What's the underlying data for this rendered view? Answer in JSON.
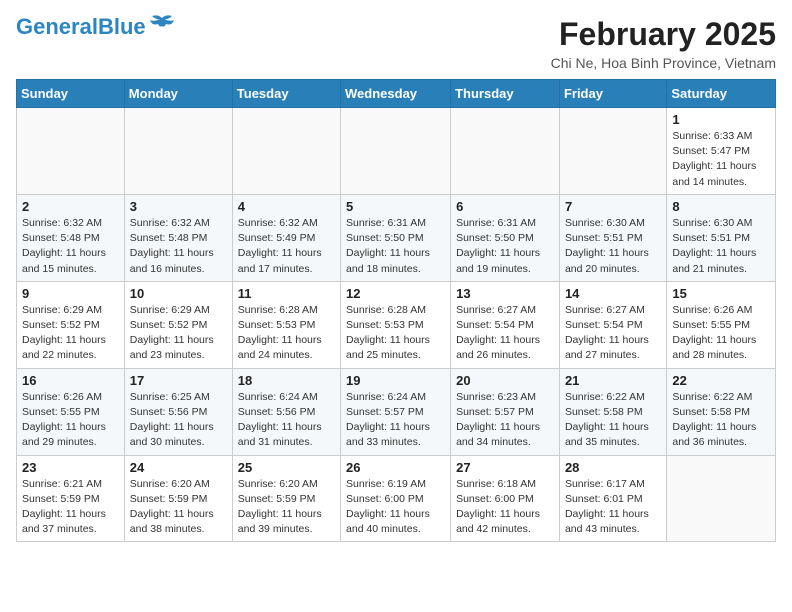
{
  "header": {
    "logo_line1": "General",
    "logo_line2": "Blue",
    "month_year": "February 2025",
    "location": "Chi Ne, Hoa Binh Province, Vietnam"
  },
  "weekdays": [
    "Sunday",
    "Monday",
    "Tuesday",
    "Wednesday",
    "Thursday",
    "Friday",
    "Saturday"
  ],
  "weeks": [
    [
      {
        "day": "",
        "info": ""
      },
      {
        "day": "",
        "info": ""
      },
      {
        "day": "",
        "info": ""
      },
      {
        "day": "",
        "info": ""
      },
      {
        "day": "",
        "info": ""
      },
      {
        "day": "",
        "info": ""
      },
      {
        "day": "1",
        "info": "Sunrise: 6:33 AM\nSunset: 5:47 PM\nDaylight: 11 hours\nand 14 minutes."
      }
    ],
    [
      {
        "day": "2",
        "info": "Sunrise: 6:32 AM\nSunset: 5:48 PM\nDaylight: 11 hours\nand 15 minutes."
      },
      {
        "day": "3",
        "info": "Sunrise: 6:32 AM\nSunset: 5:48 PM\nDaylight: 11 hours\nand 16 minutes."
      },
      {
        "day": "4",
        "info": "Sunrise: 6:32 AM\nSunset: 5:49 PM\nDaylight: 11 hours\nand 17 minutes."
      },
      {
        "day": "5",
        "info": "Sunrise: 6:31 AM\nSunset: 5:50 PM\nDaylight: 11 hours\nand 18 minutes."
      },
      {
        "day": "6",
        "info": "Sunrise: 6:31 AM\nSunset: 5:50 PM\nDaylight: 11 hours\nand 19 minutes."
      },
      {
        "day": "7",
        "info": "Sunrise: 6:30 AM\nSunset: 5:51 PM\nDaylight: 11 hours\nand 20 minutes."
      },
      {
        "day": "8",
        "info": "Sunrise: 6:30 AM\nSunset: 5:51 PM\nDaylight: 11 hours\nand 21 minutes."
      }
    ],
    [
      {
        "day": "9",
        "info": "Sunrise: 6:29 AM\nSunset: 5:52 PM\nDaylight: 11 hours\nand 22 minutes."
      },
      {
        "day": "10",
        "info": "Sunrise: 6:29 AM\nSunset: 5:52 PM\nDaylight: 11 hours\nand 23 minutes."
      },
      {
        "day": "11",
        "info": "Sunrise: 6:28 AM\nSunset: 5:53 PM\nDaylight: 11 hours\nand 24 minutes."
      },
      {
        "day": "12",
        "info": "Sunrise: 6:28 AM\nSunset: 5:53 PM\nDaylight: 11 hours\nand 25 minutes."
      },
      {
        "day": "13",
        "info": "Sunrise: 6:27 AM\nSunset: 5:54 PM\nDaylight: 11 hours\nand 26 minutes."
      },
      {
        "day": "14",
        "info": "Sunrise: 6:27 AM\nSunset: 5:54 PM\nDaylight: 11 hours\nand 27 minutes."
      },
      {
        "day": "15",
        "info": "Sunrise: 6:26 AM\nSunset: 5:55 PM\nDaylight: 11 hours\nand 28 minutes."
      }
    ],
    [
      {
        "day": "16",
        "info": "Sunrise: 6:26 AM\nSunset: 5:55 PM\nDaylight: 11 hours\nand 29 minutes."
      },
      {
        "day": "17",
        "info": "Sunrise: 6:25 AM\nSunset: 5:56 PM\nDaylight: 11 hours\nand 30 minutes."
      },
      {
        "day": "18",
        "info": "Sunrise: 6:24 AM\nSunset: 5:56 PM\nDaylight: 11 hours\nand 31 minutes."
      },
      {
        "day": "19",
        "info": "Sunrise: 6:24 AM\nSunset: 5:57 PM\nDaylight: 11 hours\nand 33 minutes."
      },
      {
        "day": "20",
        "info": "Sunrise: 6:23 AM\nSunset: 5:57 PM\nDaylight: 11 hours\nand 34 minutes."
      },
      {
        "day": "21",
        "info": "Sunrise: 6:22 AM\nSunset: 5:58 PM\nDaylight: 11 hours\nand 35 minutes."
      },
      {
        "day": "22",
        "info": "Sunrise: 6:22 AM\nSunset: 5:58 PM\nDaylight: 11 hours\nand 36 minutes."
      }
    ],
    [
      {
        "day": "23",
        "info": "Sunrise: 6:21 AM\nSunset: 5:59 PM\nDaylight: 11 hours\nand 37 minutes."
      },
      {
        "day": "24",
        "info": "Sunrise: 6:20 AM\nSunset: 5:59 PM\nDaylight: 11 hours\nand 38 minutes."
      },
      {
        "day": "25",
        "info": "Sunrise: 6:20 AM\nSunset: 5:59 PM\nDaylight: 11 hours\nand 39 minutes."
      },
      {
        "day": "26",
        "info": "Sunrise: 6:19 AM\nSunset: 6:00 PM\nDaylight: 11 hours\nand 40 minutes."
      },
      {
        "day": "27",
        "info": "Sunrise: 6:18 AM\nSunset: 6:00 PM\nDaylight: 11 hours\nand 42 minutes."
      },
      {
        "day": "28",
        "info": "Sunrise: 6:17 AM\nSunset: 6:01 PM\nDaylight: 11 hours\nand 43 minutes."
      },
      {
        "day": "",
        "info": ""
      }
    ]
  ]
}
